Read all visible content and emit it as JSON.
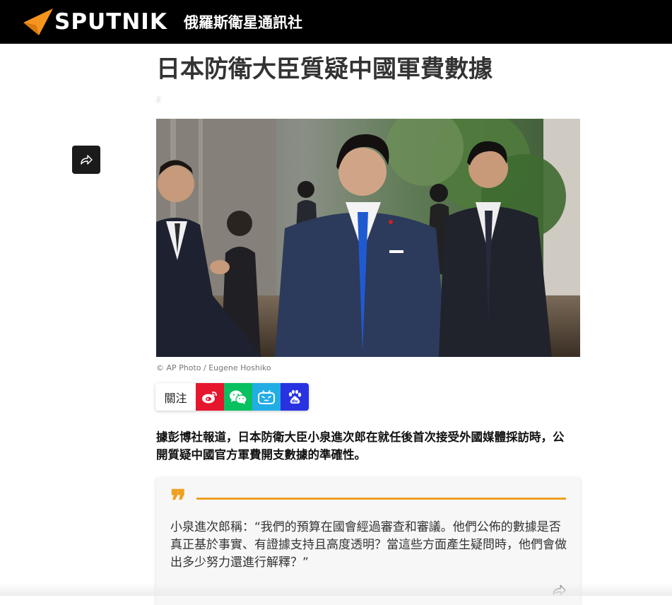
{
  "header": {
    "brand": "SPUTNIK",
    "brand_subtitle": "俄羅斯衛星通訊社",
    "logo_icon": "sputnik-arrow-logo",
    "colors": {
      "bar": "#000000",
      "logo_accent": "#f7941e"
    }
  },
  "article": {
    "title": "日本防衛大臣質疑中國軍費數據",
    "dateline": "2",
    "share_icon": "share-arrow-icon",
    "photo_credit": "© AP Photo / Eugene Hoshiko",
    "follow": {
      "label": "關注",
      "buttons": [
        {
          "icon": "weibo-icon",
          "color": "#e6162d"
        },
        {
          "icon": "wechat-icon",
          "color": "#07c160"
        },
        {
          "icon": "bilibili-icon",
          "color": "#23ade5"
        },
        {
          "icon": "baidu-icon",
          "color": "#2932e1"
        }
      ]
    },
    "lead": "據彭博社報道，日本防衛大臣小泉進次郎在就任後首次接受外國媒體採訪時，公開質疑中國官方軍費開支數據的準確性。",
    "quote": {
      "mark": "❞",
      "text": "小泉進次郎稱：“我們的預算在國會經過審查和審議。他們公佈的數據是否真正基於事實、有證據支持且高度透明？當這些方面產生疑問時，他們會做出多少努力還進行解釋？”",
      "accent_color": "#f0a020"
    }
  }
}
